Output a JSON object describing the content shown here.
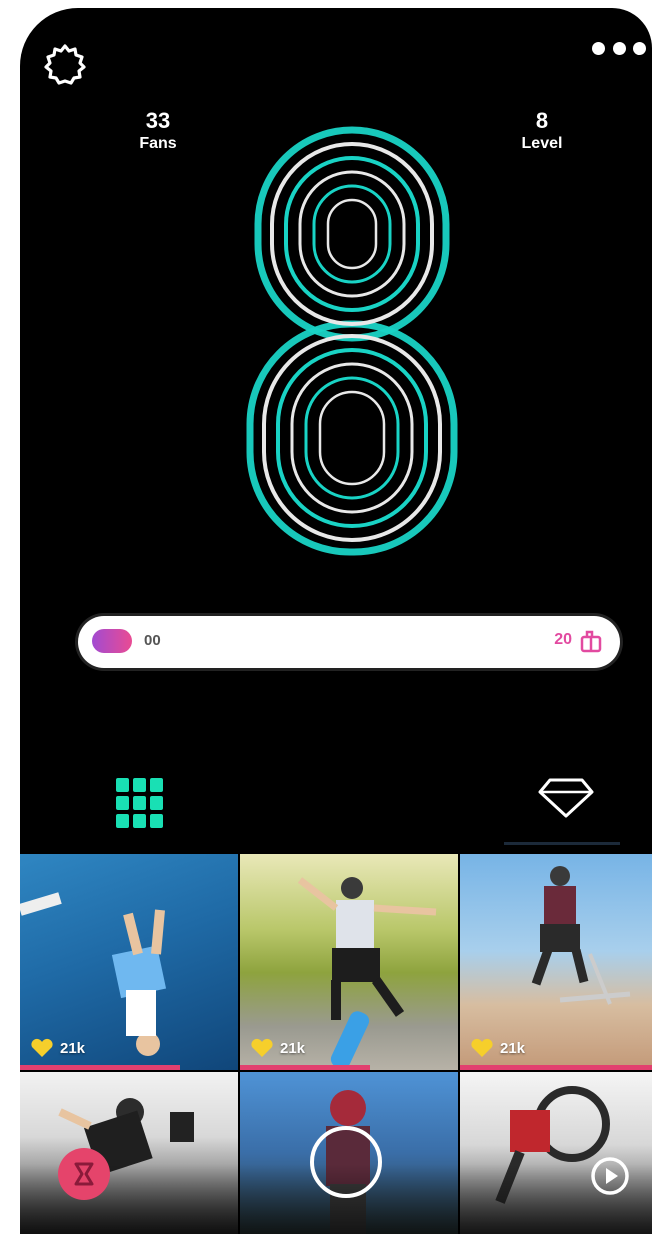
{
  "header": {
    "settings_icon": "gear-icon",
    "more_icon": "more-dots-icon"
  },
  "stats": {
    "fans": {
      "value": "33",
      "label": "Fans"
    },
    "level": {
      "value": "8",
      "label": "Level"
    }
  },
  "level_badge": {
    "value": "8",
    "colors": {
      "primary": "#19d3c5",
      "secondary": "#e8e8e8"
    }
  },
  "progress": {
    "current": "00",
    "goal": "20",
    "goal_icon": "gift-icon",
    "fill_fraction": 0.0,
    "accent": "#e24aa0"
  },
  "tabs": [
    {
      "name": "grid",
      "icon": "grid-icon",
      "active": true,
      "color": "#19e0b4"
    },
    {
      "name": "gems",
      "icon": "diamond-icon",
      "active": false
    }
  ],
  "feed": {
    "tiles": [
      {
        "likes": "21k",
        "scene": "skater-flip-over-blue-water"
      },
      {
        "likes": "21k",
        "scene": "skateboard-kickflip-trees"
      },
      {
        "likes": "21k",
        "scene": "scooter-ramp-jump"
      },
      {
        "likes": "",
        "scene": "skater-trick-grey-sky"
      },
      {
        "likes": "",
        "scene": "rider-helmet-blue-sky"
      },
      {
        "likes": "",
        "scene": "bmx-wheel-rider"
      }
    ],
    "progress_bar_color": "#e2406f"
  },
  "bottom_actions": {
    "left_icon": "pink-badge-icon",
    "center_icon": "record-icon",
    "right_icon": "play-icon"
  }
}
